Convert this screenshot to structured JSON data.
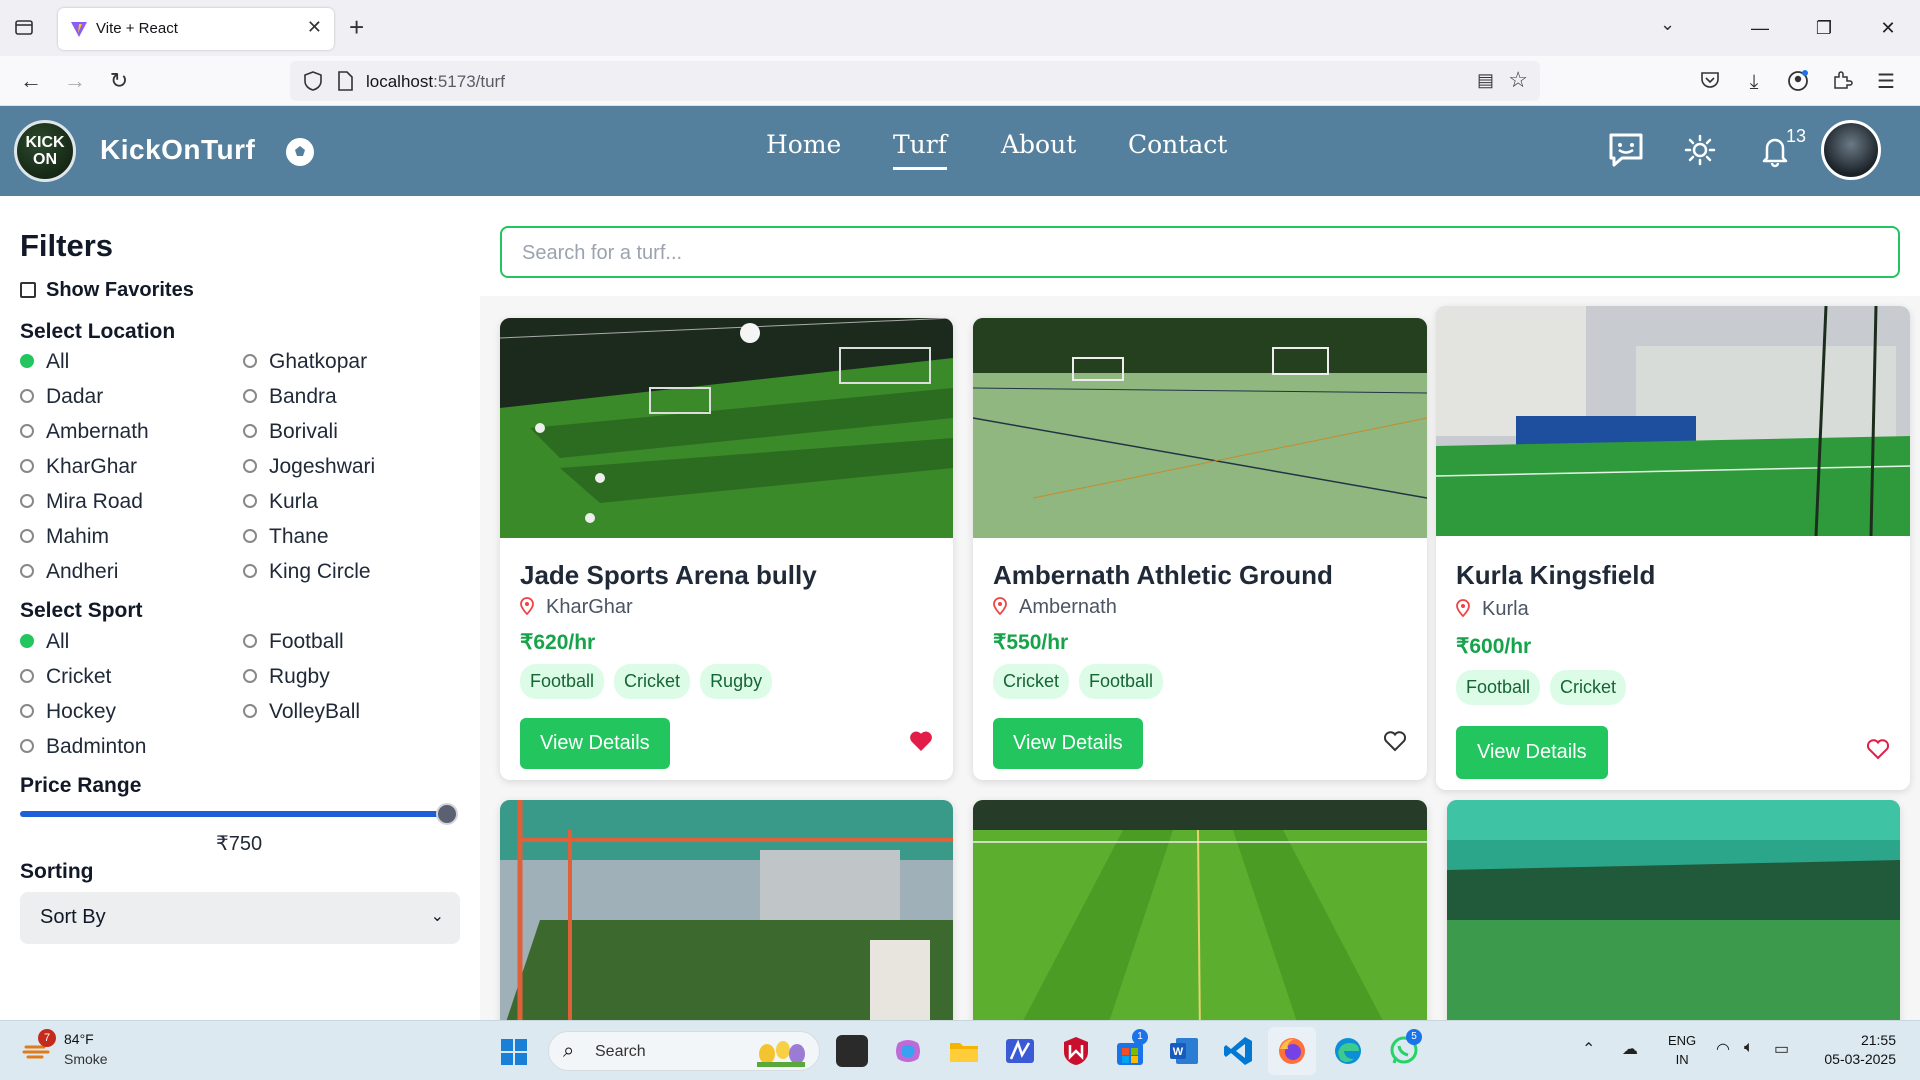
{
  "browser": {
    "tab_title": "Vite + React",
    "url_host": "localhost",
    "url_path": ":5173/turf"
  },
  "header": {
    "logo_line1": "KICK",
    "logo_line2": "ON",
    "brand": "KickOnTurf",
    "nav": [
      "Home",
      "Turf",
      "About",
      "Contact"
    ],
    "active_nav": "Turf",
    "notification_count": "13"
  },
  "filters": {
    "title": "Filters",
    "show_favorites": "Show Favorites",
    "location_label": "Select Location",
    "locations": [
      "All",
      "Ghatkopar",
      "Dadar",
      "Bandra",
      "Ambernath",
      "Borivali",
      "KharGhar",
      "Jogeshwari",
      "Mira Road",
      "Kurla",
      "Mahim",
      "Thane",
      "Andheri",
      "King Circle"
    ],
    "selected_location": "All",
    "sport_label": "Select Sport",
    "sports": [
      "All",
      "Football",
      "Cricket",
      "Rugby",
      "Hockey",
      "VolleyBall",
      "Badminton"
    ],
    "selected_sport": "All",
    "price_label": "Price Range",
    "price_value": "₹750",
    "price_fraction": 1.0,
    "sorting_label": "Sorting",
    "sort_value": "Sort By"
  },
  "search": {
    "placeholder": "Search for a turf..."
  },
  "turfs": [
    {
      "name": "Jade Sports Arena bully",
      "location": "KharGhar",
      "price": "₹620/hr",
      "sports": [
        "Football",
        "Cricket",
        "Rugby"
      ],
      "button": "View Details",
      "favorite": true
    },
    {
      "name": "Ambernath Athletic Ground",
      "location": "Ambernath",
      "price": "₹550/hr",
      "sports": [
        "Cricket",
        "Football"
      ],
      "button": "View Details",
      "favorite": false
    },
    {
      "name": "Kurla Kingsfield",
      "location": "Kurla",
      "price": "₹600/hr",
      "sports": [
        "Football",
        "Cricket"
      ],
      "button": "View Details",
      "favorite": false
    }
  ],
  "taskbar": {
    "weather_badge": "7",
    "temperature": "84°F",
    "weather": "Smoke",
    "search_label": "Search",
    "badge_store": "1",
    "badge_whatsapp": "5",
    "lang_line1": "ENG",
    "lang_line2": "IN",
    "time": "21:55",
    "date": "05-03-2025"
  },
  "colors": {
    "header": "#54809e",
    "accent_green": "#22c55e",
    "price_green": "#16a34a",
    "slider_blue": "#1d5fd6",
    "heart_red": "#e11d48"
  }
}
